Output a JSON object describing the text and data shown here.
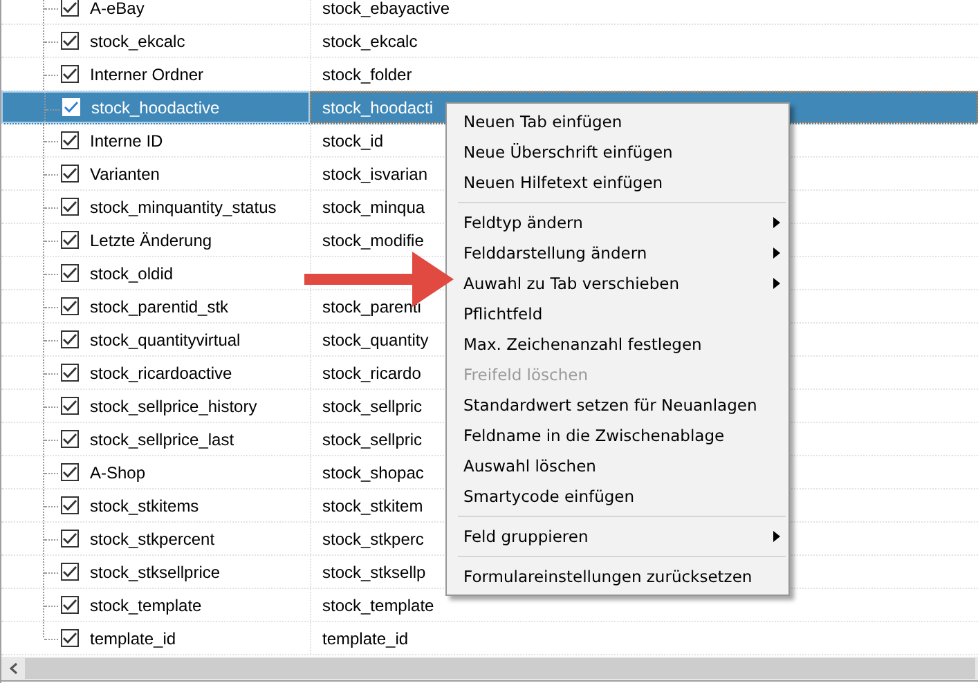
{
  "rows": [
    {
      "label": "A-eBay",
      "field": "stock_ebayactive",
      "checked": true,
      "selected": false
    },
    {
      "label": "stock_ekcalc",
      "field": "stock_ekcalc",
      "checked": true,
      "selected": false
    },
    {
      "label": "Interner Ordner",
      "field": "stock_folder",
      "checked": true,
      "selected": false
    },
    {
      "label": "stock_hoodactive",
      "field": "stock_hoodacti",
      "checked": true,
      "selected": true
    },
    {
      "label": "Interne ID",
      "field": "stock_id",
      "checked": true,
      "selected": false
    },
    {
      "label": "Varianten",
      "field": "stock_isvarian",
      "checked": true,
      "selected": false
    },
    {
      "label": "stock_minquantity_status",
      "field": "stock_minqua",
      "checked": true,
      "selected": false
    },
    {
      "label": "Letzte Änderung",
      "field": "stock_modifie",
      "checked": true,
      "selected": false
    },
    {
      "label": "stock_oldid",
      "checked": true,
      "selected": false
    },
    {
      "label": "stock_parentid_stk",
      "field": "stock_parenti",
      "checked": true,
      "selected": false
    },
    {
      "label": "stock_quantityvirtual",
      "field": "stock_quantity",
      "checked": true,
      "selected": false
    },
    {
      "label": "stock_ricardoactive",
      "field": "stock_ricardo",
      "checked": true,
      "selected": false
    },
    {
      "label": "stock_sellprice_history",
      "field": "stock_sellpric",
      "checked": true,
      "selected": false
    },
    {
      "label": "stock_sellprice_last",
      "field": "stock_sellpric",
      "checked": true,
      "selected": false
    },
    {
      "label": "A-Shop",
      "field": "stock_shopac",
      "checked": true,
      "selected": false
    },
    {
      "label": "stock_stkitems",
      "field": "stock_stkitem",
      "checked": true,
      "selected": false
    },
    {
      "label": "stock_stkpercent",
      "field": "stock_stkperc",
      "checked": true,
      "selected": false
    },
    {
      "label": "stock_stksellprice",
      "field": "stock_stksellp",
      "checked": true,
      "selected": false
    },
    {
      "label": "stock_template",
      "field": "stock_template",
      "checked": true,
      "selected": false
    },
    {
      "label": "template_id",
      "field": "template_id",
      "checked": true,
      "selected": false
    }
  ],
  "context_menu": {
    "items": [
      {
        "kind": "item",
        "label": "Neuen Tab einfügen",
        "disabled": false,
        "submenu": false
      },
      {
        "kind": "item",
        "label": "Neue Überschrift einfügen",
        "disabled": false,
        "submenu": false
      },
      {
        "kind": "item",
        "label": "Neuen Hilfetext einfügen",
        "disabled": false,
        "submenu": false
      },
      {
        "kind": "separator"
      },
      {
        "kind": "item",
        "label": "Feldtyp ändern",
        "disabled": false,
        "submenu": true
      },
      {
        "kind": "item",
        "label": "Felddarstellung ändern",
        "disabled": false,
        "submenu": true
      },
      {
        "kind": "item",
        "label": "Auwahl zu Tab verschieben",
        "disabled": false,
        "submenu": true
      },
      {
        "kind": "item",
        "label": "Pflichtfeld",
        "disabled": false,
        "submenu": false
      },
      {
        "kind": "item",
        "label": "Max. Zeichenanzahl festlegen",
        "disabled": false,
        "submenu": false
      },
      {
        "kind": "item",
        "label": "Freifeld löschen",
        "disabled": true,
        "submenu": false
      },
      {
        "kind": "item",
        "label": "Standardwert setzen für Neuanlagen",
        "disabled": false,
        "submenu": false
      },
      {
        "kind": "item",
        "label": "Feldname in die Zwischenablage",
        "disabled": false,
        "submenu": false
      },
      {
        "kind": "item",
        "label": "Auswahl löschen",
        "disabled": false,
        "submenu": false
      },
      {
        "kind": "item",
        "label": "Smartycode einfügen",
        "disabled": false,
        "submenu": false
      },
      {
        "kind": "separator"
      },
      {
        "kind": "item",
        "label": "Feld gruppieren",
        "disabled": false,
        "submenu": true
      },
      {
        "kind": "separator"
      },
      {
        "kind": "item",
        "label": "Formulareinstellungen zurücksetzen",
        "disabled": false,
        "submenu": false
      }
    ]
  }
}
